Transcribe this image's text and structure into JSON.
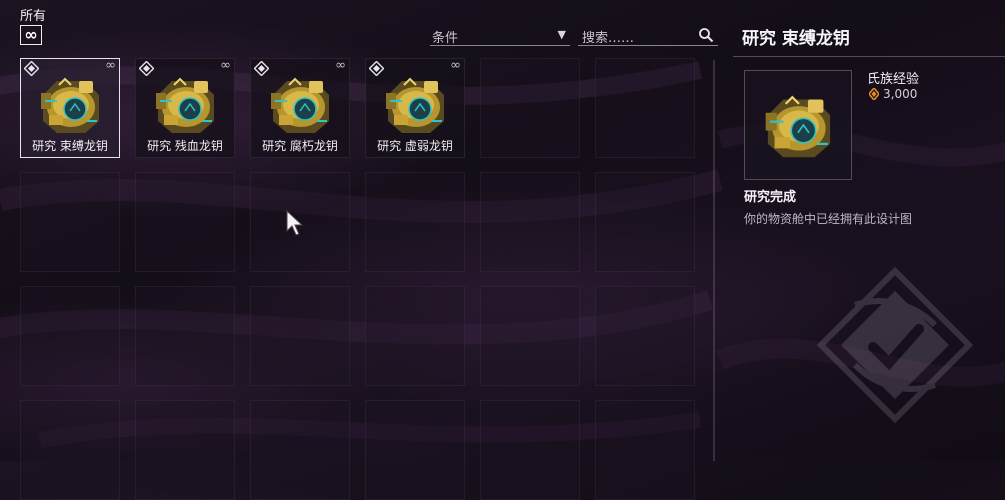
{
  "filter": {
    "label": "所有",
    "toggle_symbol": "∞"
  },
  "condition_select": {
    "value": "条件",
    "arrow": "▼"
  },
  "search": {
    "placeholder": "搜索……"
  },
  "items": [
    {
      "label": "研究 束缚龙钥",
      "selected": true
    },
    {
      "label": "研究 残血龙钥",
      "selected": false
    },
    {
      "label": "研究 腐朽龙钥",
      "selected": false
    },
    {
      "label": "研究 虚弱龙钥",
      "selected": false
    }
  ],
  "infinity_symbol": "∞",
  "detail": {
    "title": "研究 束缚龙钥",
    "affinity_label": "氏族经验",
    "affinity_value": "3,000",
    "status_title": "研究完成",
    "status_desc": "你的物资舱中已经拥有此设计图"
  },
  "colors": {
    "accent_gold": "#c9a53a",
    "accent_teal": "#2ec4c8",
    "affinity_orange": "#e08a2a"
  }
}
